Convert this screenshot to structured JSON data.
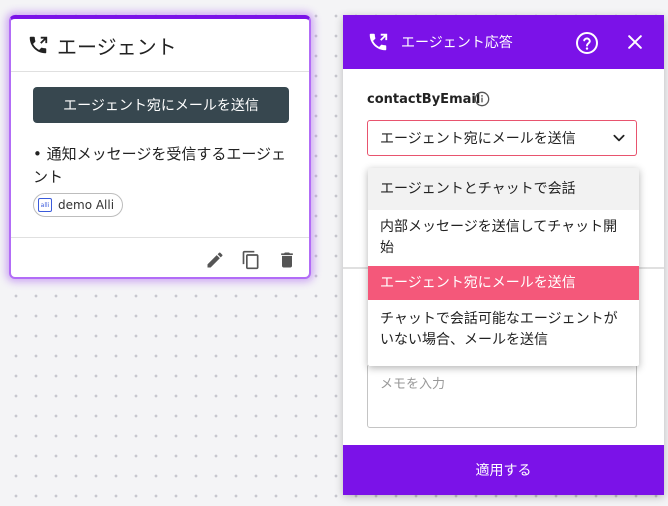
{
  "node": {
    "title": "エージェント",
    "button_label": "エージェント宛にメールを送信",
    "description": "• 通知メッセージを受信するエージェント",
    "chip_label": "demo Alli",
    "chip_logo": "alli",
    "icons": [
      "phone-forward-icon",
      "edit-icon",
      "copy-icon",
      "delete-icon"
    ]
  },
  "panel": {
    "title": "エージェント応答",
    "field_label": "contactByEmail",
    "selected_value": "エージェント宛にメールを送信",
    "memo_placeholder": "メモを入力",
    "apply_label": "適用する",
    "accent_color": "#7b12e8"
  },
  "dropdown": {
    "options": [
      "エージェントとチャットで会話",
      "内部メッセージを送信してチャット開始",
      "エージェント宛にメールを送信",
      "チャットで会話可能なエージェントがいない場合、メールを送信"
    ],
    "hovered_index": 0,
    "selected_index": 2,
    "selected_color": "#f4587a"
  }
}
